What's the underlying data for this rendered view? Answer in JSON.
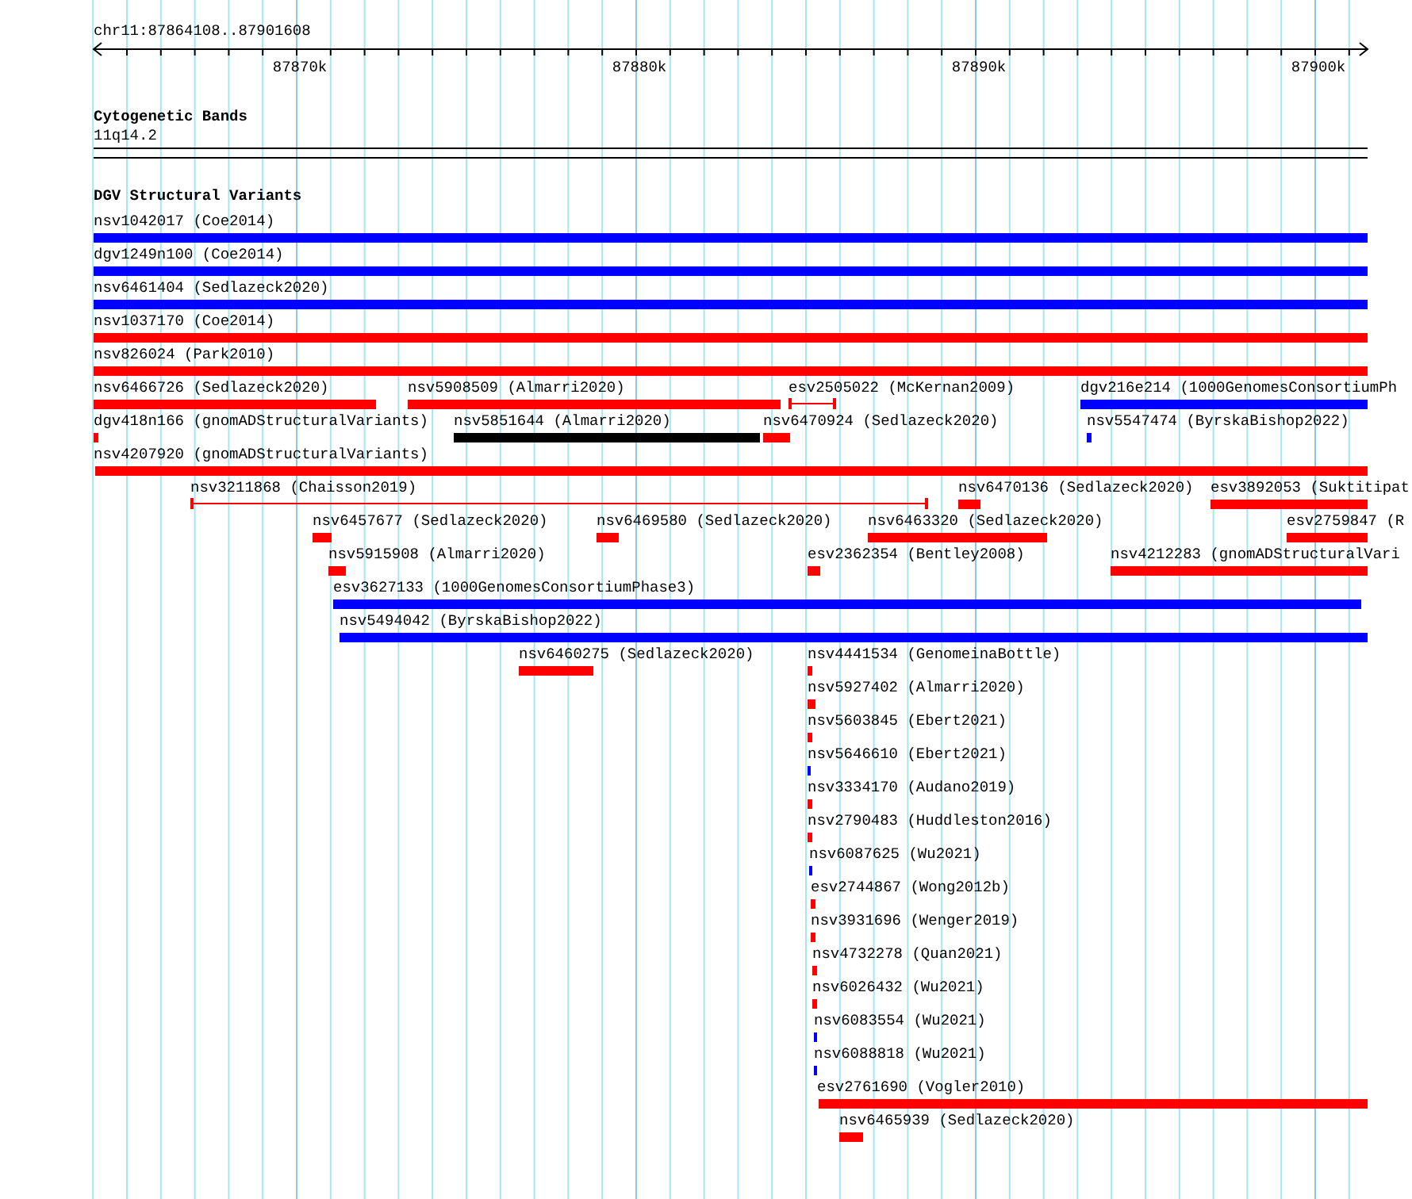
{
  "ruler": {
    "location": "chr11:87864108..87901608",
    "ticks": [
      "87870k",
      "87880k",
      "87890k",
      "87900k"
    ]
  },
  "cytogenetic_bands": {
    "title": "Cytogenetic Bands",
    "band": "11q14.2"
  },
  "structural_variants": {
    "title": "DGV Structural Variants",
    "rows": [
      {
        "features": [
          {
            "label": "nsv1042017 (Coe2014)",
            "kind": "bar",
            "color": "#0000ff"
          }
        ]
      },
      {
        "features": [
          {
            "label": "dgv1249n100 (Coe2014)",
            "kind": "bar",
            "color": "#0000ff"
          }
        ]
      },
      {
        "features": [
          {
            "label": "nsv6461404 (Sedlazeck2020)",
            "kind": "bar",
            "color": "#0000ff"
          }
        ]
      },
      {
        "features": [
          {
            "label": "nsv1037170 (Coe2014)",
            "kind": "bar",
            "color": "#ff0000"
          }
        ]
      },
      {
        "features": [
          {
            "label": "nsv826024 (Park2010)",
            "kind": "bar",
            "color": "#ff0000"
          }
        ]
      },
      {
        "features": [
          {
            "label": "nsv6466726 (Sedlazeck2020)",
            "kind": "bar",
            "color": "#ff0000"
          },
          {
            "label": "nsv5908509 (Almarri2020)",
            "kind": "bar",
            "color": "#ff0000"
          },
          {
            "label": "esv2505022 (McKernan2009)",
            "kind": "span",
            "color": "#ff0000"
          },
          {
            "label": "dgv216e214 (1000GenomesConsortiumPh",
            "kind": "bar",
            "color": "#0000ff"
          }
        ]
      },
      {
        "features": [
          {
            "label": "dgv418n166 (gnomADStructuralVariants)",
            "kind": "bar",
            "color": "#ff0000"
          },
          {
            "label": "nsv5851644 (Almarri2020)",
            "kind": "bar",
            "color": "#000000"
          },
          {
            "label": "nsv6470924 (Sedlazeck2020)",
            "kind": "bar",
            "color": "#ff0000"
          },
          {
            "label": "nsv5547474 (ByrskaBishop2022)",
            "kind": "bar",
            "color": "#0000ff"
          }
        ]
      },
      {
        "features": [
          {
            "label": "nsv4207920 (gnomADStructuralVariants)",
            "kind": "bar",
            "color": "#ff0000"
          }
        ]
      },
      {
        "features": [
          {
            "label": "nsv3211868 (Chaisson2019)",
            "kind": "span",
            "color": "#ff0000"
          },
          {
            "label": "nsv6470136 (Sedlazeck2020)",
            "kind": "bar",
            "color": "#ff0000"
          },
          {
            "label": "esv3892053 (Suktitipat",
            "kind": "bar",
            "color": "#ff0000"
          }
        ]
      },
      {
        "features": [
          {
            "label": "nsv6457677 (Sedlazeck2020)",
            "kind": "bar",
            "color": "#ff0000"
          },
          {
            "label": "nsv6469580 (Sedlazeck2020)",
            "kind": "bar",
            "color": "#ff0000"
          },
          {
            "label": "nsv6463320 (Sedlazeck2020)",
            "kind": "bar",
            "color": "#ff0000"
          },
          {
            "label": "esv2759847 (R",
            "kind": "bar",
            "color": "#ff0000"
          }
        ]
      },
      {
        "features": [
          {
            "label": "nsv5915908 (Almarri2020)",
            "kind": "bar",
            "color": "#ff0000"
          },
          {
            "label": "esv2362354 (Bentley2008)",
            "kind": "bar",
            "color": "#ff0000"
          },
          {
            "label": "nsv4212283 (gnomADStructuralVari",
            "kind": "bar",
            "color": "#ff0000"
          }
        ]
      },
      {
        "features": [
          {
            "label": "esv3627133 (1000GenomesConsortiumPhase3)",
            "kind": "bar",
            "color": "#0000ff"
          }
        ]
      },
      {
        "features": [
          {
            "label": "nsv5494042 (ByrskaBishop2022)",
            "kind": "bar",
            "color": "#0000ff"
          }
        ]
      },
      {
        "features": [
          {
            "label": "nsv6460275 (Sedlazeck2020)",
            "kind": "bar",
            "color": "#ff0000"
          },
          {
            "label": "nsv4441534 (GenomeinaBottle)",
            "kind": "bar",
            "color": "#ff0000"
          }
        ]
      },
      {
        "features": [
          {
            "label": "nsv5927402 (Almarri2020)",
            "kind": "bar",
            "color": "#ff0000"
          }
        ]
      },
      {
        "features": [
          {
            "label": "nsv5603845 (Ebert2021)",
            "kind": "bar",
            "color": "#ff0000"
          }
        ]
      },
      {
        "features": [
          {
            "label": "nsv5646610 (Ebert2021)",
            "kind": "bar",
            "color": "#0000ff"
          }
        ]
      },
      {
        "features": [
          {
            "label": "nsv3334170 (Audano2019)",
            "kind": "bar",
            "color": "#ff0000"
          }
        ]
      },
      {
        "features": [
          {
            "label": "nsv2790483 (Huddleston2016)",
            "kind": "bar",
            "color": "#ff0000"
          }
        ]
      },
      {
        "features": [
          {
            "label": "nsv6087625 (Wu2021)",
            "kind": "bar",
            "color": "#0000ff"
          }
        ]
      },
      {
        "features": [
          {
            "label": "esv2744867 (Wong2012b)",
            "kind": "bar",
            "color": "#ff0000"
          }
        ]
      },
      {
        "features": [
          {
            "label": "nsv3931696 (Wenger2019)",
            "kind": "bar",
            "color": "#ff0000"
          }
        ]
      },
      {
        "features": [
          {
            "label": "nsv4732278 (Quan2021)",
            "kind": "bar",
            "color": "#ff0000"
          }
        ]
      },
      {
        "features": [
          {
            "label": "nsv6026432 (Wu2021)",
            "kind": "bar",
            "color": "#ff0000"
          }
        ]
      },
      {
        "features": [
          {
            "label": "nsv6083554 (Wu2021)",
            "kind": "bar",
            "color": "#0000ff"
          }
        ]
      },
      {
        "features": [
          {
            "label": "nsv6088818 (Wu2021)",
            "kind": "bar",
            "color": "#0000ff"
          }
        ]
      },
      {
        "features": [
          {
            "label": "esv2761690 (Vogler2010)",
            "kind": "bar",
            "color": "#ff0000"
          }
        ]
      },
      {
        "features": [
          {
            "label": "nsv6465939 (Sedlazeck2020)",
            "kind": "bar",
            "color": "#ff0000"
          }
        ]
      }
    ]
  }
}
